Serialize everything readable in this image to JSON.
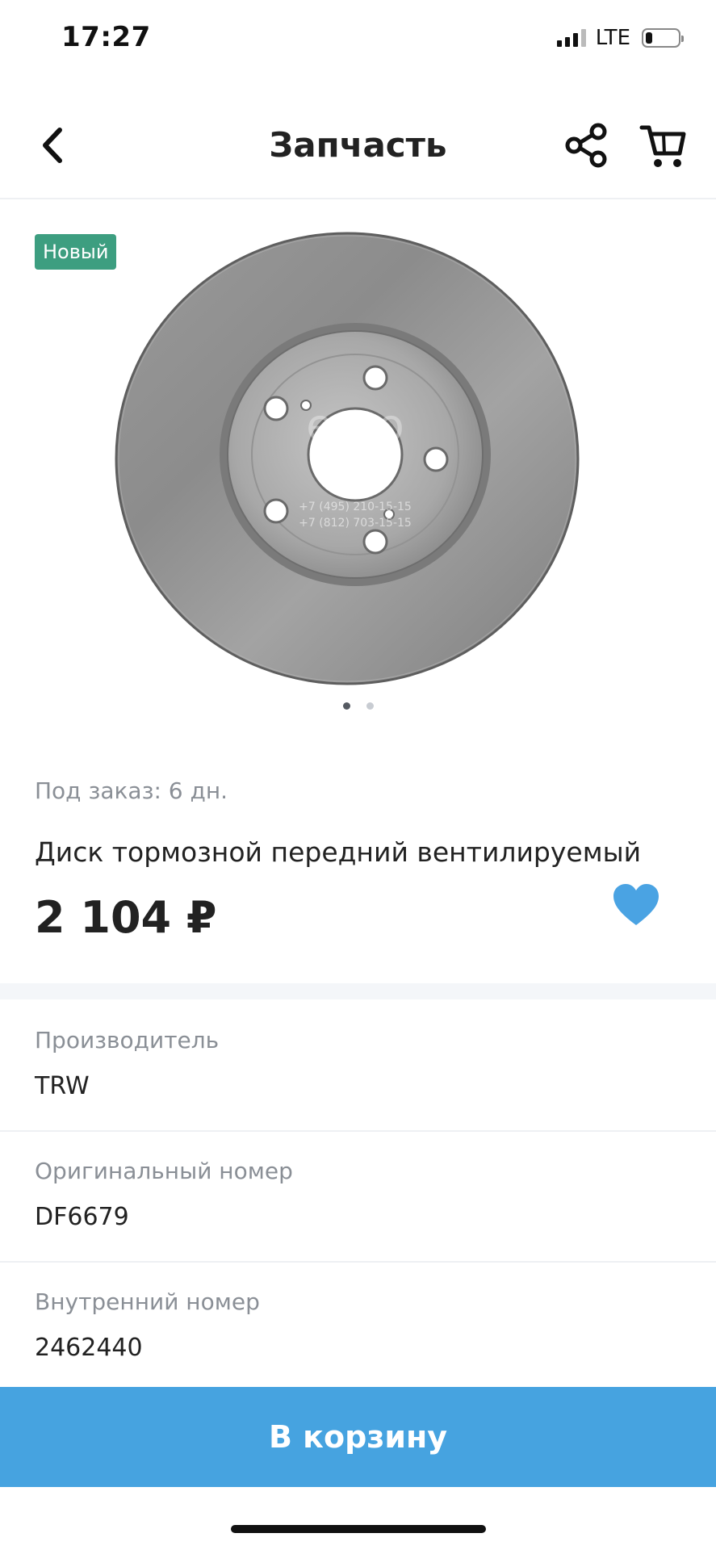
{
  "status": {
    "time": "17:27",
    "network": "LTE"
  },
  "nav": {
    "title": "Запчасть"
  },
  "product": {
    "badge": "Новый",
    "watermark_logo": "euro",
    "watermark_phone_1": "+7 (495) 210-15-15",
    "watermark_phone_2": "+7 (812) 703-15-15",
    "gallery_page": 1,
    "gallery_total": 2,
    "availability": "Под заказ: 6 дн.",
    "title": "Диск тормозной передний вентилируемый",
    "price": "2 104 ₽",
    "favorite": true
  },
  "attributes": [
    {
      "label": "Производитель",
      "value": "TRW"
    },
    {
      "label": "Оригинальный номер",
      "value": "DF6679"
    },
    {
      "label": "Внутренний номер",
      "value": "2462440"
    }
  ],
  "actions": {
    "add_to_cart": "В корзину"
  },
  "colors": {
    "accent": "#46a3e0",
    "badge": "#3d9e80",
    "heart": "#4aa3e3"
  },
  "icons": {
    "back": "chevron-left-icon",
    "share": "share-icon",
    "cart": "cart-icon",
    "favorite": "heart-icon"
  }
}
